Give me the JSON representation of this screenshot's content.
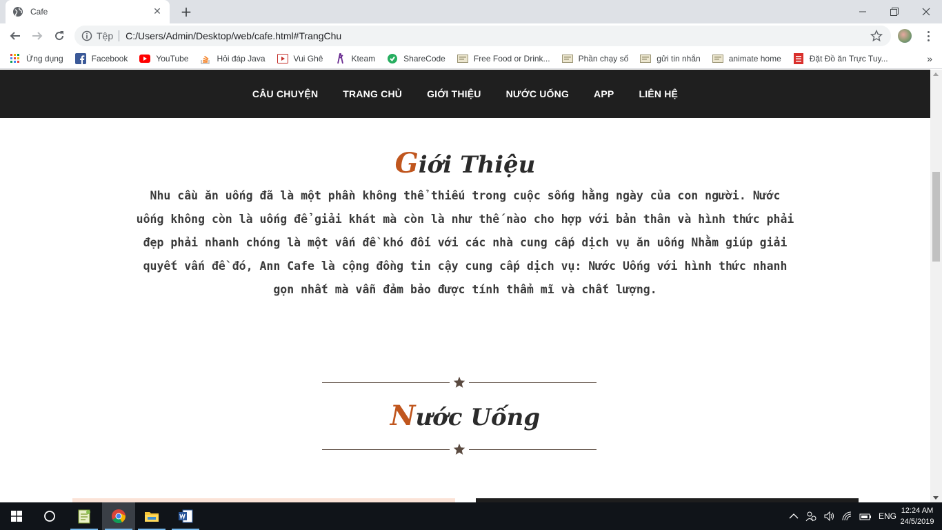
{
  "browser": {
    "tab_title": "Cafe",
    "address_chip": "Tệp",
    "url": "C:/Users/Admin/Desktop/web/cafe.html#TrangChu"
  },
  "bookmarks": [
    {
      "label": "Ứng dụng",
      "icon": "apps-grid-icon"
    },
    {
      "label": "Facebook",
      "icon": "facebook-icon"
    },
    {
      "label": "YouTube",
      "icon": "youtube-icon"
    },
    {
      "label": "Hỏi đáp Java",
      "icon": "stackoverflow-icon"
    },
    {
      "label": "Vui Ghê",
      "icon": "play-icon"
    },
    {
      "label": "Kteam",
      "icon": "kteam-icon"
    },
    {
      "label": "ShareCode",
      "icon": "sharecode-icon"
    },
    {
      "label": "Free Food or Drink...",
      "icon": "page-icon"
    },
    {
      "label": "Phần chạy số",
      "icon": "page-icon"
    },
    {
      "label": "gửi tin nhắn",
      "icon": "page-icon"
    },
    {
      "label": "animate home",
      "icon": "page-icon"
    },
    {
      "label": "Đặt Đồ ăn Trực Tuy...",
      "icon": "red-doc-icon"
    }
  ],
  "site_nav": [
    "CÂU CHUYỆN",
    "TRANG CHỦ",
    "GIỚI THIỆU",
    "NƯỚC UỐNG",
    "APP",
    "LIÊN HỆ"
  ],
  "intro": {
    "title_first": "G",
    "title_rest": "iới Thiệu",
    "text": "Nhu cầu ăn uống đã là một phần không thể thiếu trong cuộc sống hằng ngày của con người. Nước uống không còn là uống để giải khát mà còn là như thế nào cho hợp với bản thân và hình thức phải đẹp phải nhanh chóng là một vấn đề khó đối với các nhà cung cấp dịch vụ ăn uống Nhằm giúp giải quyết vấn đề đó, Ann Cafe là cộng đồng tin cậy cung cấp dịch vụ: Nước Uống với hình thức nhanh gọn nhất mà vẫn đảm bảo được tính thẩm mĩ và chất lượng."
  },
  "drinks": {
    "title_first": "N",
    "title_rest": "ước Uống"
  },
  "taskbar": {
    "time": "12:24 AM",
    "date": "24/5/2019",
    "lang": "ENG"
  },
  "colors": {
    "nav_bg": "#1f1f1f",
    "accent": "#c0561e",
    "taskbar_bg": "#101419"
  }
}
